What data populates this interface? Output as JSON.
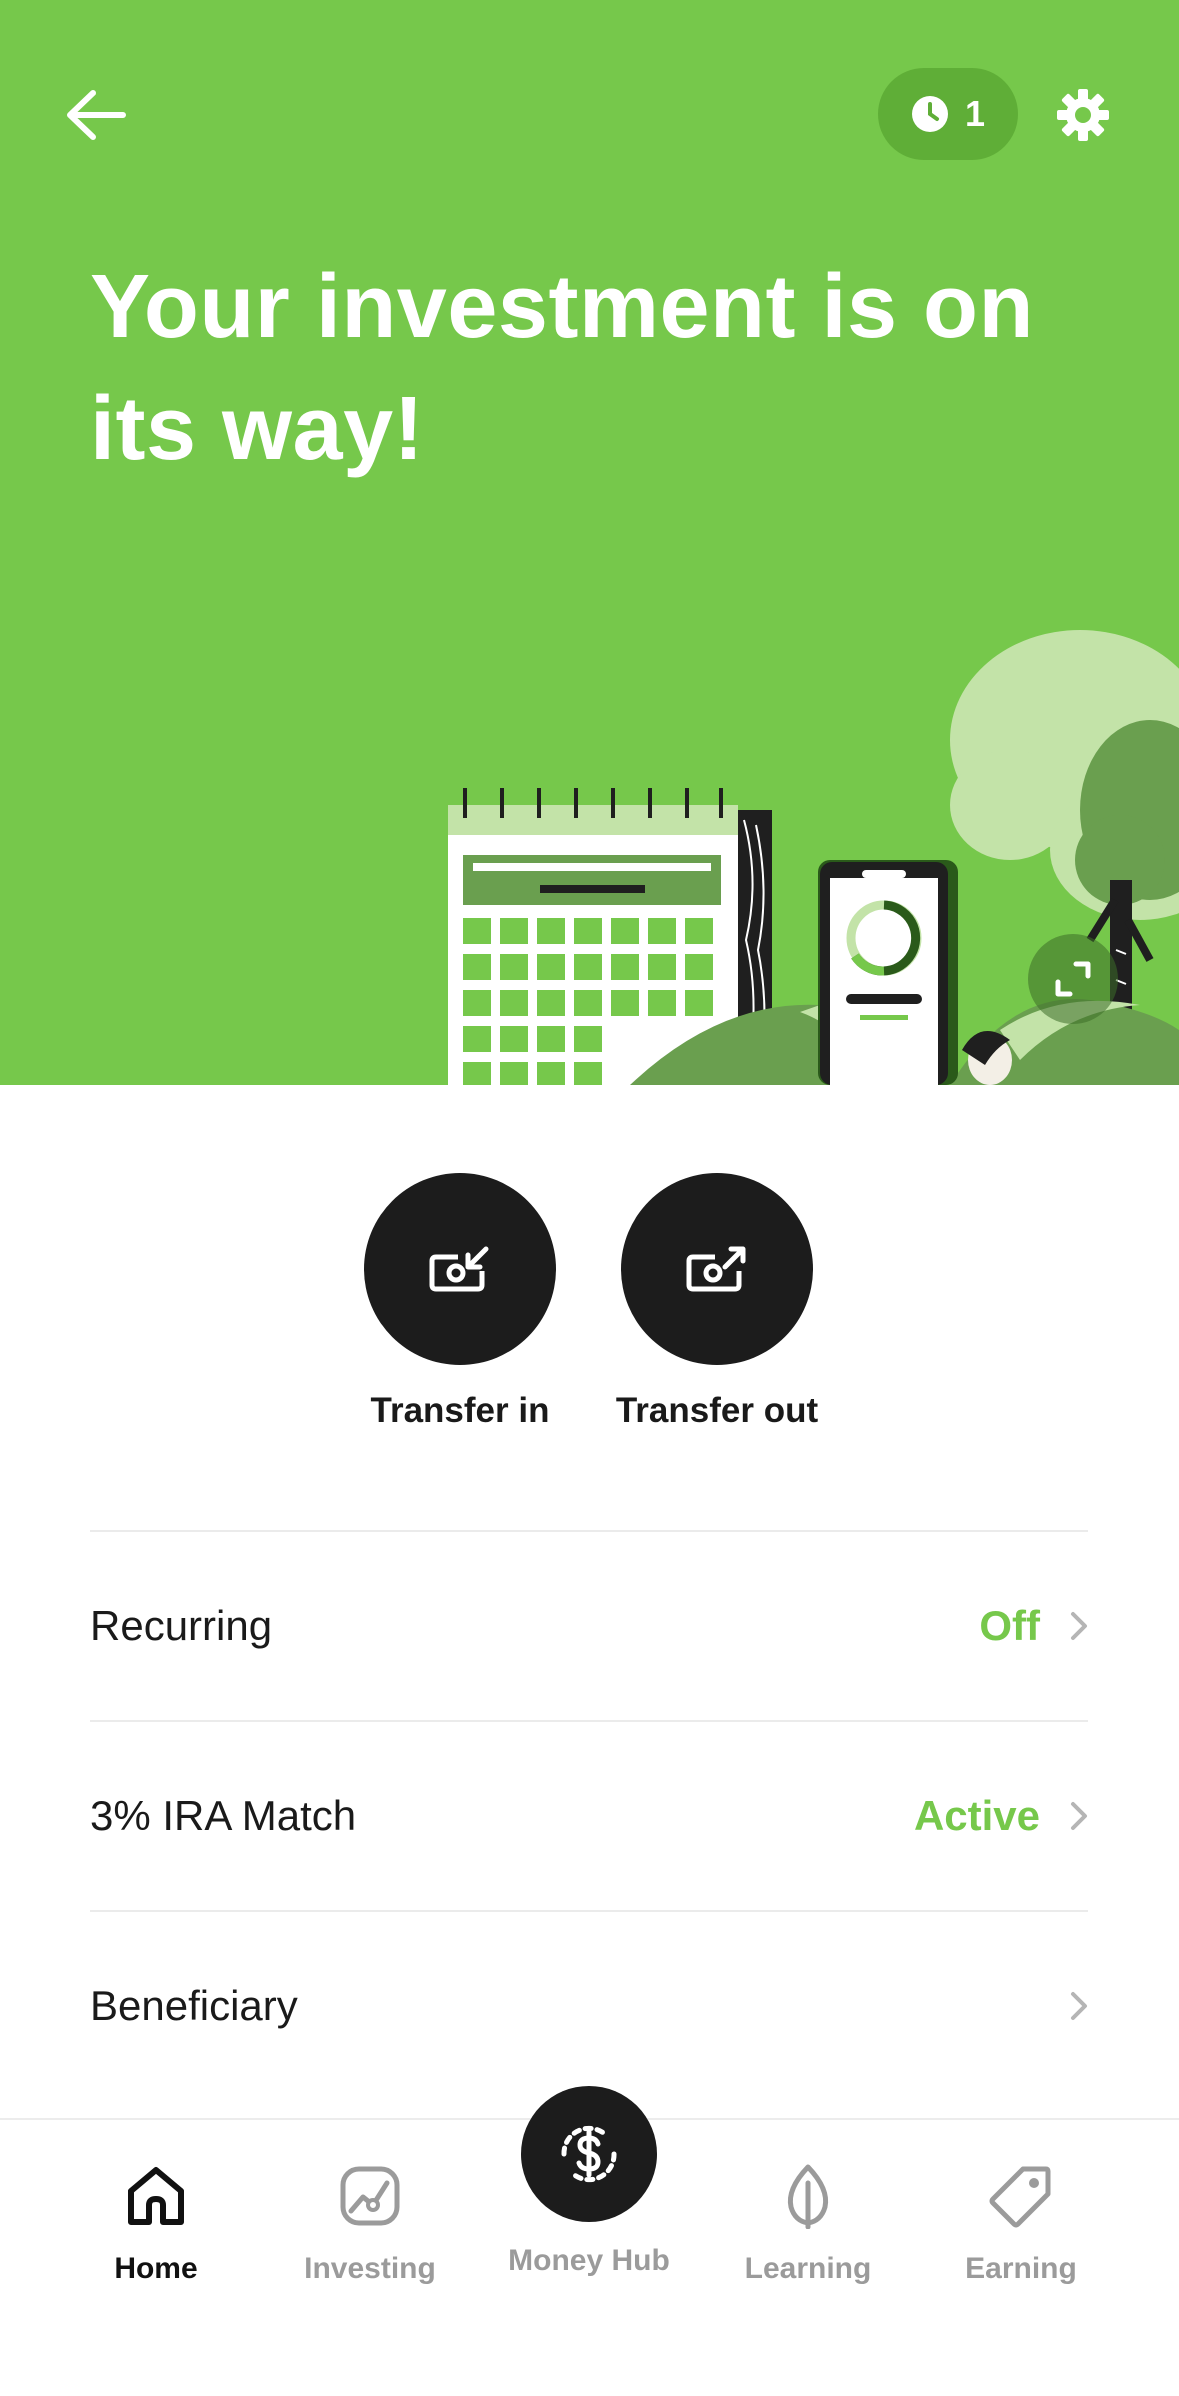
{
  "header": {
    "pending_count": "1",
    "title": "Your investment is on its way!"
  },
  "actions": {
    "transfer_in_label": "Transfer in",
    "transfer_out_label": "Transfer out"
  },
  "rows": {
    "recurring": {
      "label": "Recurring",
      "status": "Off"
    },
    "ira_match": {
      "label": "3% IRA Match",
      "status": "Active"
    },
    "beneficiary": {
      "label": "Beneficiary"
    }
  },
  "tabbar": {
    "home": "Home",
    "investing": "Investing",
    "money_hub": "Money Hub",
    "learning": "Learning",
    "earning": "Earning"
  },
  "colors": {
    "brand_green": "#76c84b",
    "pill_green": "#5fae37",
    "dark": "#1c1c1c",
    "inactive_gray": "#9b9b9b"
  },
  "icons": {
    "back": "arrow-left-icon",
    "pending": "clock-icon",
    "settings": "gear-icon",
    "expand": "expand-icon",
    "transfer_in": "money-in-icon",
    "transfer_out": "money-out-icon",
    "chevron": "chevron-right-icon",
    "home": "home-icon",
    "investing": "chart-icon",
    "money_hub": "dollar-icon",
    "learning": "leaf-icon",
    "earning": "tag-icon"
  }
}
